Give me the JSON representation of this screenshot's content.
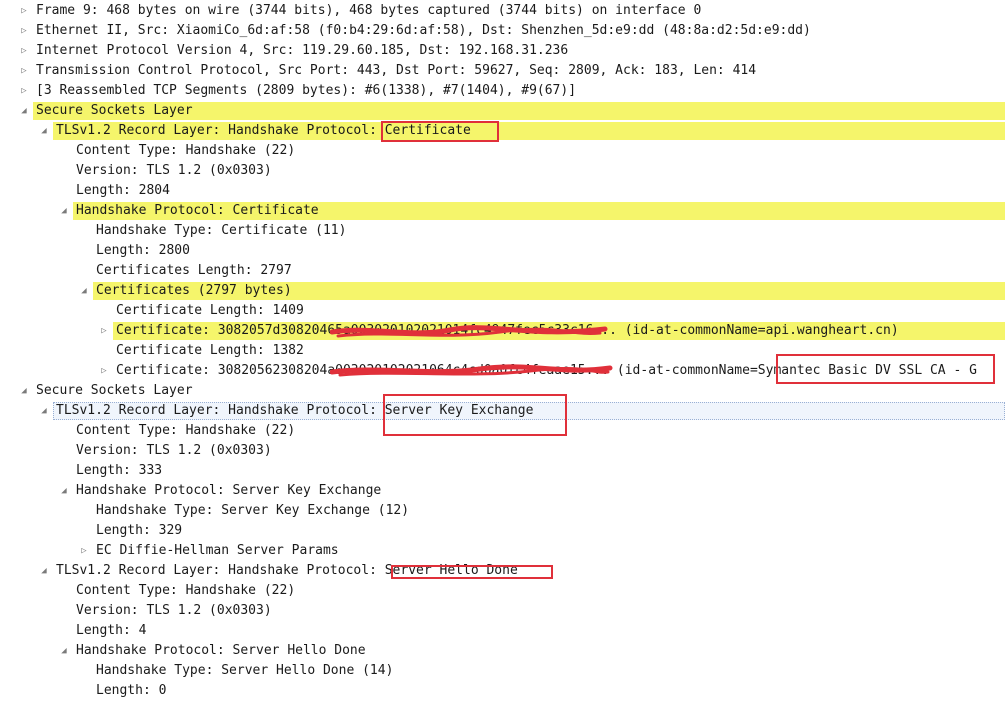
{
  "annotation_color": "#e0303a",
  "highlight_color": "#f5f56b",
  "rows": [
    {
      "text": "Frame 9: 468 bytes on wire (3744 bits), 468 bytes captured (3744 bits) on interface 0",
      "level": 0,
      "toggle": "collapsed",
      "hl": false
    },
    {
      "text": "Ethernet II, Src: XiaomiCo_6d:af:58 (f0:b4:29:6d:af:58), Dst: Shenzhen_5d:e9:dd (48:8a:d2:5d:e9:dd)",
      "level": 0,
      "toggle": "collapsed",
      "hl": false
    },
    {
      "text": "Internet Protocol Version 4, Src: 119.29.60.185, Dst: 192.168.31.236",
      "level": 0,
      "toggle": "collapsed",
      "hl": false
    },
    {
      "text": "Transmission Control Protocol, Src Port: 443, Dst Port: 59627, Seq: 2809, Ack: 183, Len: 414",
      "level": 0,
      "toggle": "collapsed",
      "hl": false
    },
    {
      "text": "[3 Reassembled TCP Segments (2809 bytes): #6(1338), #7(1404), #9(67)]",
      "level": 0,
      "toggle": "collapsed",
      "hl": false
    },
    {
      "text": "Secure Sockets Layer",
      "level": 0,
      "toggle": "expanded",
      "hl": true
    },
    {
      "text": "TLSv1.2 Record Layer: Handshake Protocol: Certificate",
      "level": 1,
      "toggle": "expanded",
      "hl": true
    },
    {
      "text": "Content Type: Handshake (22)",
      "level": 2,
      "toggle": "none",
      "hl": false
    },
    {
      "text": "Version: TLS 1.2 (0x0303)",
      "level": 2,
      "toggle": "none",
      "hl": false
    },
    {
      "text": "Length: 2804",
      "level": 2,
      "toggle": "none",
      "hl": false
    },
    {
      "text": "Handshake Protocol: Certificate",
      "level": 2,
      "toggle": "expanded",
      "hl": true
    },
    {
      "text": "Handshake Type: Certificate (11)",
      "level": 3,
      "toggle": "none",
      "hl": false
    },
    {
      "text": "Length: 2800",
      "level": 3,
      "toggle": "none",
      "hl": false
    },
    {
      "text": "Certificates Length: 2797",
      "level": 3,
      "toggle": "none",
      "hl": false
    },
    {
      "text": "Certificates (2797 bytes)",
      "level": 3,
      "toggle": "expanded",
      "hl": true
    },
    {
      "text": "Certificate Length: 1409",
      "level": 4,
      "toggle": "none",
      "hl": false
    },
    {
      "text": "Certificate: 3082057d30820465a003020102021014fc4947fec5c33c16... (id-at-commonName=api.wangheart.cn)",
      "level": 4,
      "toggle": "collapsed",
      "hl": true
    },
    {
      "text": "Certificate Length: 1382",
      "level": 4,
      "toggle": "none",
      "hl": false
    },
    {
      "text": "Certificate: 30820562308204a003020102021064c4cd0a0fc4feaae15... (id-at-commonName=Symantec Basic DV SSL CA - G",
      "level": 4,
      "toggle": "collapsed",
      "hl": false
    },
    {
      "text": "Secure Sockets Layer",
      "level": 0,
      "toggle": "expanded",
      "hl": false
    },
    {
      "text": "TLSv1.2 Record Layer: Handshake Protocol: Server Key Exchange",
      "level": 1,
      "toggle": "expanded",
      "hl": false,
      "selected": true
    },
    {
      "text": "Content Type: Handshake (22)",
      "level": 2,
      "toggle": "none",
      "hl": false
    },
    {
      "text": "Version: TLS 1.2 (0x0303)",
      "level": 2,
      "toggle": "none",
      "hl": false
    },
    {
      "text": "Length: 333",
      "level": 2,
      "toggle": "none",
      "hl": false
    },
    {
      "text": "Handshake Protocol: Server Key Exchange",
      "level": 2,
      "toggle": "expanded",
      "hl": false
    },
    {
      "text": "Handshake Type: Server Key Exchange (12)",
      "level": 3,
      "toggle": "none",
      "hl": false
    },
    {
      "text": "Length: 329",
      "level": 3,
      "toggle": "none",
      "hl": false
    },
    {
      "text": "EC Diffie-Hellman Server Params",
      "level": 3,
      "toggle": "collapsed",
      "hl": false
    },
    {
      "text": "TLSv1.2 Record Layer: Handshake Protocol: Server Hello Done",
      "level": 1,
      "toggle": "expanded",
      "hl": false
    },
    {
      "text": "Content Type: Handshake (22)",
      "level": 2,
      "toggle": "none",
      "hl": false
    },
    {
      "text": "Version: TLS 1.2 (0x0303)",
      "level": 2,
      "toggle": "none",
      "hl": false
    },
    {
      "text": "Length: 4",
      "level": 2,
      "toggle": "none",
      "hl": false
    },
    {
      "text": "Handshake Protocol: Server Hello Done",
      "level": 2,
      "toggle": "expanded",
      "hl": false
    },
    {
      "text": "Handshake Type: Server Hello Done (14)",
      "level": 3,
      "toggle": "none",
      "hl": false
    },
    {
      "text": "Length: 0",
      "level": 3,
      "toggle": "none",
      "hl": false
    }
  ]
}
